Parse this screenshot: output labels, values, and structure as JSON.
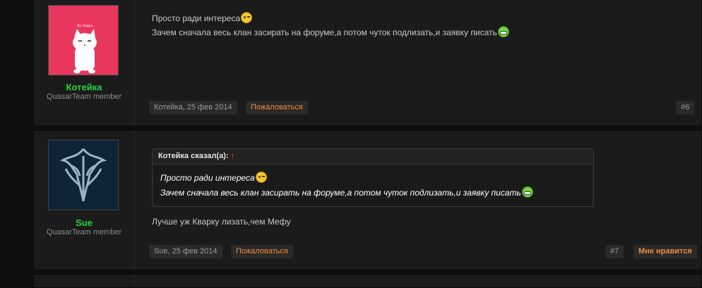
{
  "posts": [
    {
      "username": "Котейка",
      "user_title": "QuasarTeam member",
      "avatar_icon": "white-cat-on-pink-avatar",
      "avatar_caption": "Be Happy...",
      "message_lines": [
        "Просто ради интереса",
        "Зачем сначала весь клан засирать на форуме,а потом чуток подлизать,и заявку писать"
      ],
      "smileys": [
        "wink-smiley-icon",
        "grin-smiley-icon"
      ],
      "date": "Котейка, 25 фев 2014",
      "report_label": "Пожаловаться",
      "post_number": "#6"
    },
    {
      "username": "Sue",
      "user_title": "QuasarTeam member",
      "avatar_icon": "elven-emblem-avatar",
      "quote": {
        "header": "Котейка сказал(а):",
        "arrow": "↑",
        "lines": [
          "Просто ради интереса",
          "Зачем сначала весь клан засирать на форуме,а потом чуток подлизать,и заявку писать"
        ]
      },
      "message": "Лучше уж Кварку лизать,чем Мефу",
      "date": "Sue, 25 фев 2014",
      "report_label": "Пожаловаться",
      "post_number": "#7",
      "dislike_label": "Мне нравится"
    }
  ],
  "colors": {
    "background": "#0e0e0e",
    "post_bg": "#1b1b1b",
    "username": "#28d43c",
    "action_orange": "#f0883c",
    "quote_arrow": "#f05a1e"
  }
}
